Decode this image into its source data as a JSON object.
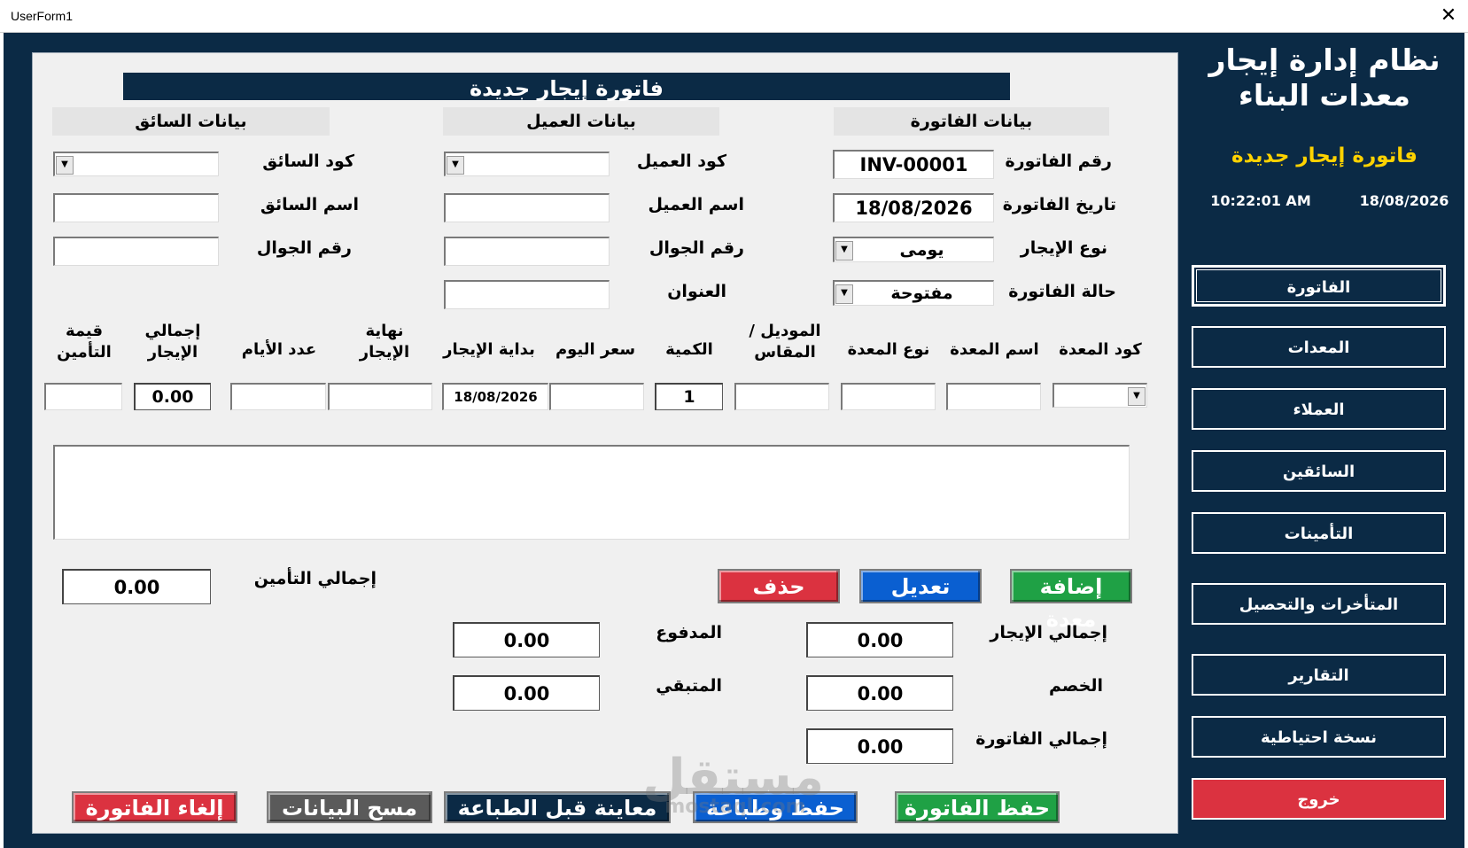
{
  "window": {
    "title": "UserForm1",
    "close_glyph": "✕"
  },
  "form": {
    "banner": "فاتورة إيجار جديدة",
    "sections": {
      "invoice": "بيانات الفاتورة",
      "customer": "بيانات العميل",
      "driver": "بيانات السائق"
    },
    "invoice": {
      "number_label": "رقم الفاتورة",
      "number_value": "INV-00001",
      "date_label": "تاريخ الفاتورة",
      "date_value": "18/08/2026",
      "rent_type_label": "نوع الإيجار",
      "rent_type_value": "يومى",
      "status_label": "حالة الفاتورة",
      "status_value": "مفتوحة"
    },
    "customer": {
      "code_label": "كود العميل",
      "code_value": "",
      "name_label": "اسم العميل",
      "name_value": "",
      "mobile_label": "رقم الجوال",
      "mobile_value": "",
      "address_label": "العنوان",
      "address_value": ""
    },
    "driver": {
      "code_label": "كود السائق",
      "code_value": "",
      "name_label": "اسم السائق",
      "name_value": "",
      "mobile_label": "رقم الجوال",
      "mobile_value": ""
    },
    "equipment": {
      "headers": {
        "code": "كود المعدة",
        "name": "اسم المعدة",
        "type": "نوع المعدة",
        "model": "الموديل / المقاس",
        "qty": "الكمية",
        "day_price": "سعر اليوم",
        "start": "بداية الإيجار",
        "end": "نهاية الإيجار",
        "days": "عدد الأيام",
        "total_rent": "إجمالي الإيجار",
        "insurance": "قيمة التأمين"
      },
      "values": {
        "code": "",
        "name": "",
        "type": "",
        "model": "",
        "qty": "1",
        "day_price": "",
        "start": "18/08/2026",
        "end": "",
        "days": "",
        "total_rent": "0.00",
        "insurance": ""
      }
    },
    "actions": {
      "add": "إضافة معدة",
      "edit": "تعديل",
      "delete": "حذف"
    },
    "totals": {
      "insurance_total_label": "إجمالي التأمين",
      "insurance_total_value": "0.00",
      "rent_total_label": "إجمالي الإيجار",
      "rent_total_value": "0.00",
      "discount_label": "الخصم",
      "discount_value": "0.00",
      "invoice_total_label": "إجمالي الفاتورة",
      "invoice_total_value": "0.00",
      "paid_label": "المدفوع",
      "paid_value": "0.00",
      "remaining_label": "المتبقي",
      "remaining_value": "0.00"
    },
    "footer": {
      "save": "حفظ الفاتورة",
      "save_print": "حفظ وطباعة",
      "preview": "معاينة قبل الطباعة",
      "clear": "مسح البيانات",
      "cancel": "إلغاء الفاتورة"
    }
  },
  "sidebar": {
    "app_title": "نظام إدارة إيجار معدات البناء",
    "subtitle": "فاتورة إيجار جديدة",
    "date": "18/08/2026",
    "time": "10:22:01 AM",
    "nav": [
      {
        "label": "الفاتورة",
        "active": true
      },
      {
        "label": "المعدات"
      },
      {
        "label": "العملاء"
      },
      {
        "label": "السائقين"
      },
      {
        "label": "التأمينات"
      },
      {
        "label": "المتأخرات والتحصيل"
      },
      {
        "label": "التقارير"
      },
      {
        "label": "نسخة احتياطية"
      },
      {
        "label": "خروج"
      }
    ]
  },
  "watermark": {
    "ar": "مستقل",
    "en": "mostaql.com"
  },
  "colors": {
    "navy": "#0b2a45",
    "green": "#1fa145",
    "blue": "#0a5fd1",
    "red": "#db3240",
    "gray": "#5a5a5a",
    "yellow": "#ffd200",
    "panel": "#f0f0f0"
  }
}
